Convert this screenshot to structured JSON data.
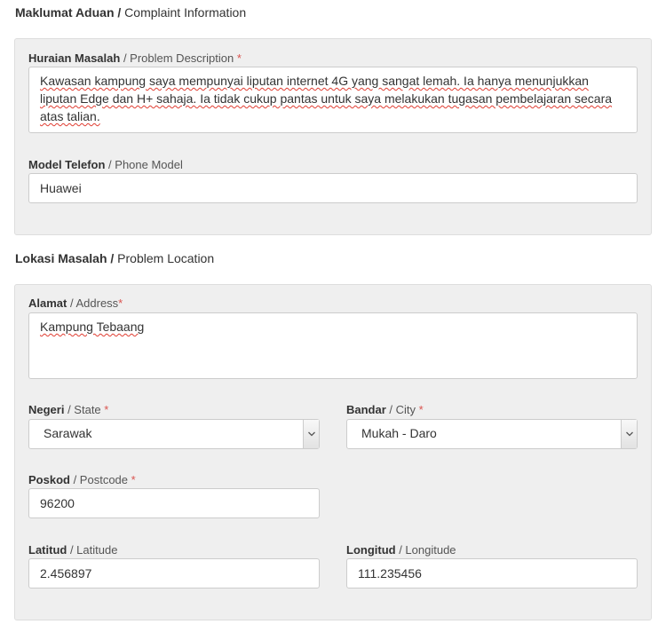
{
  "complaint_section": {
    "title_ms": "Maklumat Aduan",
    "title_sep": " / ",
    "title_en": "Complaint Information",
    "description": {
      "label_ms": "Huraian Masalah",
      "label_en": " / Problem Description",
      "required": " *",
      "value": "Kawasan kampung saya mempunyai liputan internet 4G yang sangat lemah. Ia hanya menunjukkan liputan Edge dan H+ sahaja. Ia tidak cukup pantas untuk saya melakukan tugasan pembelajaran secara atas talian."
    },
    "phone_model": {
      "label_ms": "Model Telefon",
      "label_en": " / Phone Model",
      "value": "Huawei"
    }
  },
  "location_section": {
    "title_ms": "Lokasi Masalah",
    "title_sep": " / ",
    "title_en": "Problem Location",
    "address": {
      "label_ms": "Alamat",
      "label_en": " / Address",
      "required": "*",
      "value": "Kampung Tebaang"
    },
    "state": {
      "label_ms": "Negeri",
      "label_en": " / State",
      "required": " *",
      "selected": "Sarawak"
    },
    "city": {
      "label_ms": "Bandar",
      "label_en": " / City",
      "required": " *",
      "selected": "Mukah - Daro"
    },
    "postcode": {
      "label_ms": "Poskod",
      "label_en": " / Postcode",
      "required": " *",
      "value": "96200"
    },
    "latitude": {
      "label_ms": "Latitud",
      "label_en": " / Latitude",
      "value": "2.456897"
    },
    "longitude": {
      "label_ms": "Longitud",
      "label_en": " / Longitude",
      "value": "111.235456"
    }
  },
  "icons": {
    "dropdown": "chevron-down-icon"
  }
}
